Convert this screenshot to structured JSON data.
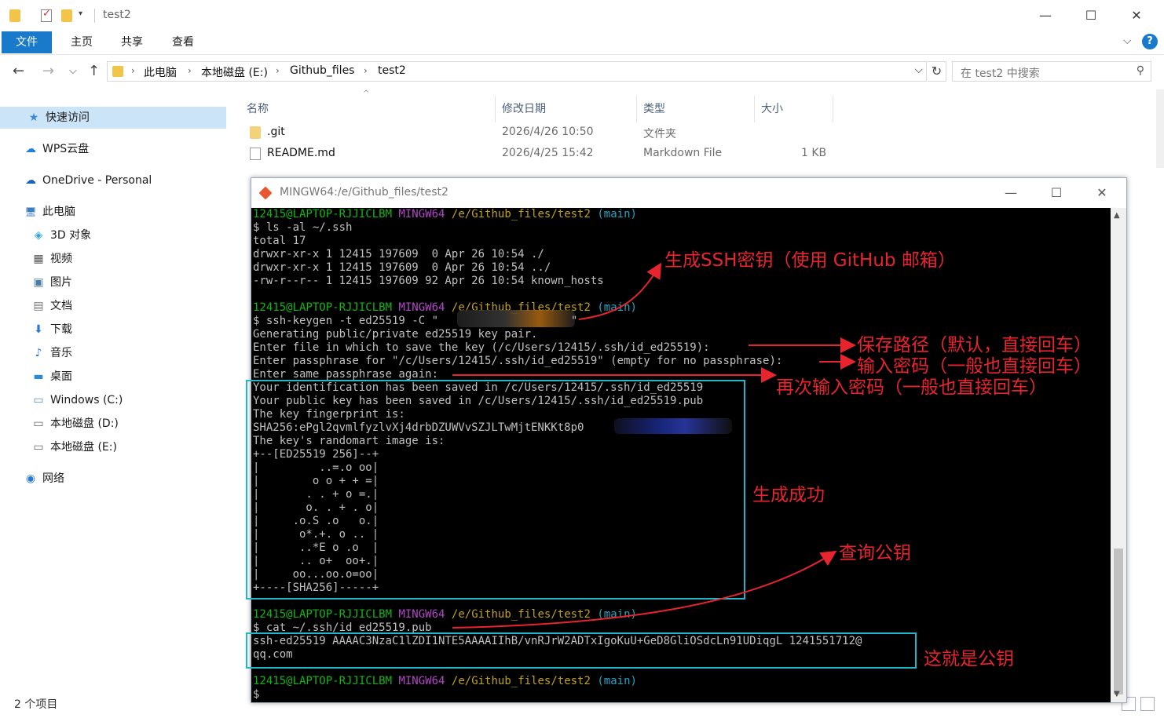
{
  "window": {
    "title": "test2",
    "controls": {
      "minimize": "—",
      "maximize": "☐",
      "close": "✕"
    }
  },
  "ribbon": {
    "tabs": [
      "文件",
      "主页",
      "共享",
      "查看"
    ],
    "expand": "⌵",
    "help": "?"
  },
  "address": {
    "breadcrumbs": [
      "此电脑",
      "本地磁盘 (E:)",
      "Github_files",
      "test2"
    ],
    "separator": "›",
    "search_placeholder": "在 test2 中搜索"
  },
  "sidebar": {
    "items": [
      {
        "label": "快速访问",
        "icon": "star-icon",
        "glyph": "★"
      },
      {
        "label": "WPS云盘",
        "icon": "cloud-icon",
        "glyph": "☁"
      },
      {
        "label": "OneDrive - Personal",
        "icon": "onedrive-icon",
        "glyph": "☁"
      },
      {
        "label": "此电脑",
        "icon": "computer-icon",
        "glyph": "🖥"
      },
      {
        "label": "3D 对象",
        "icon": "cube-icon",
        "glyph": "◈"
      },
      {
        "label": "视频",
        "icon": "video-icon",
        "glyph": "▦"
      },
      {
        "label": "图片",
        "icon": "picture-icon",
        "glyph": "▣"
      },
      {
        "label": "文档",
        "icon": "document-icon",
        "glyph": "▤"
      },
      {
        "label": "下载",
        "icon": "download-icon",
        "glyph": "⬇"
      },
      {
        "label": "音乐",
        "icon": "music-icon",
        "glyph": "♪"
      },
      {
        "label": "桌面",
        "icon": "desktop-icon",
        "glyph": "▬"
      },
      {
        "label": "Windows (C:)",
        "icon": "drive-c-icon",
        "glyph": "▭"
      },
      {
        "label": "本地磁盘 (D:)",
        "icon": "drive-d-icon",
        "glyph": "▭"
      },
      {
        "label": "本地磁盘 (E:)",
        "icon": "drive-e-icon",
        "glyph": "▭"
      },
      {
        "label": "网络",
        "icon": "network-icon",
        "glyph": "◉"
      }
    ]
  },
  "filelist": {
    "columns": [
      "名称",
      "修改日期",
      "类型",
      "大小"
    ],
    "rows": [
      {
        "name": ".git",
        "date": "2026/4/26 10:50",
        "type": "文件夹",
        "size": ""
      },
      {
        "name": "README.md",
        "date": "2026/4/25 15:42",
        "type": "Markdown File",
        "size": "1 KB"
      }
    ]
  },
  "statusbar": {
    "text": "2 个项目"
  },
  "terminal": {
    "title": "MINGW64:/e/Github_files/test2",
    "prompt": {
      "user": "12415@LAPTOP-RJJICLBM",
      "shell": "MINGW64",
      "path": "/e/Github_files/test2",
      "branch": "(main)"
    },
    "lines": [
      "$ ls -al ~/.ssh",
      "total 17",
      "drwxr-xr-x 1 12415 197609  0 Apr 26 10:54 ./",
      "drwxr-xr-x 1 12415 197609  0 Apr 26 10:54 ../",
      "-rw-r--r-- 1 12415 197609 92 Apr 26 10:54 known_hosts",
      "$ ssh-keygen -t ed25519 -C \"",
      "Generating public/private ed25519 key pair.",
      "Enter file in which to save the key (/c/Users/12415/.ssh/id_ed25519):",
      "Enter passphrase for \"/c/Users/12415/.ssh/id_ed25519\" (empty for no passphrase):",
      "Enter same passphrase again:",
      "Your identification has been saved in /c/Users/12415/.ssh/id_ed25519",
      "Your public key has been saved in /c/Users/12415/.ssh/id_ed25519.pub",
      "The key fingerprint is:",
      "SHA256:ePgl2qvmlfyzlvXj4drbDZUWVvSZJLTwMjtENKKt8p0",
      "The key's randomart image is:",
      "+--[ED25519 256]--+",
      "|         ..=.o oo|",
      "|        o o + + =|",
      "|       . . + o =.|",
      "|       o. . + . o|",
      "|     .o.S .o   o.|",
      "|      o*.+. o .. |",
      "|      ..*E o .o  |",
      "|      .. o+  oo+.|",
      "|     oo...oo.o=oo|",
      "+----[SHA256]-----+",
      "$ cat ~/.ssh/id_ed25519.pub",
      "ssh-ed25519 AAAAC3NzaC1lZDI1NTE5AAAAIIhB/vnRJrW2ADTxIgoKuU+GeD8GliOSdcLn91UDiqgL 1241551712@",
      "qq.com",
      "$ "
    ]
  },
  "annotations": {
    "gen_key": "生成SSH密钥（使用 GitHub 邮箱）",
    "save_path": "保存路径（默认，直接回车）",
    "passphrase": "输入密码（一般也直接回车）",
    "passphrase_again": "再次输入密码（一般也直接回车）",
    "success": "生成成功",
    "query_key": "查询公钥",
    "this_is_key": "这就是公钥",
    "color": "#e8242f",
    "box_color": "#21b6c8"
  }
}
